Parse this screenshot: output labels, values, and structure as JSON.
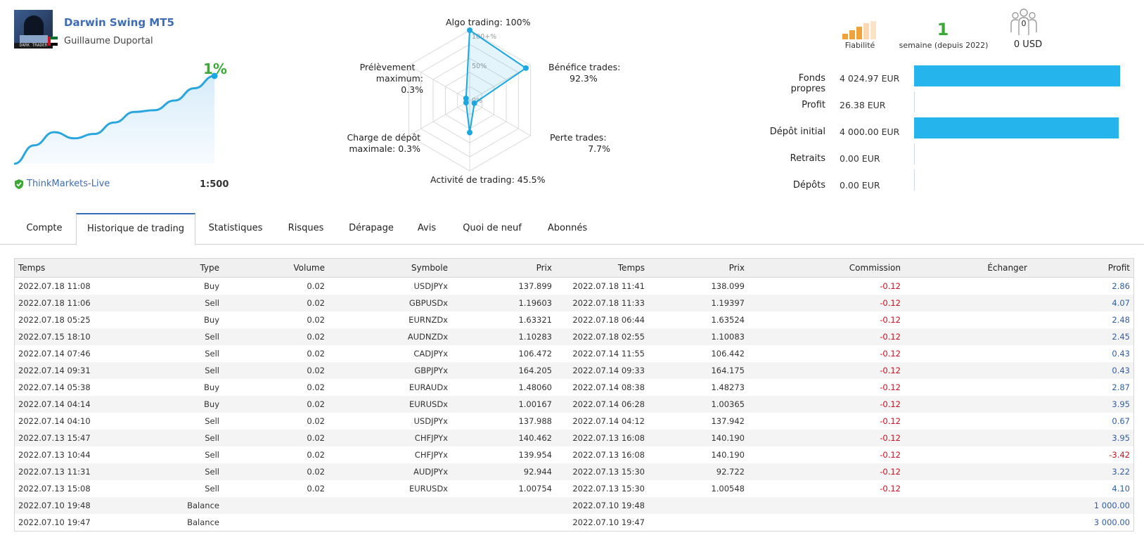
{
  "signal": {
    "title": "Darwin Swing MT5",
    "author": "Guillaume Duportal",
    "avatar_caption": "DARK TRADER",
    "growth": "1%",
    "broker": "ThinkMarkets-Live",
    "leverage": "1:500",
    "growth_curve": [
      0,
      2.1,
      3.6,
      2.9,
      3.4,
      4.7,
      5.9,
      6.1,
      7.2,
      8.6,
      10.0
    ]
  },
  "radar": {
    "labels": {
      "algo": "Algo trading: 100%",
      "profit_trades_1": "Bénéfice trades:",
      "profit_trades_2": "92.3%",
      "loss_trades_1": "Perte trades:",
      "loss_trades_2": "7.7%",
      "activity": "Activité de trading: 45.5%",
      "deposit_load_1": "Charge de dépôt",
      "deposit_load_2": "maximale: 0.3%",
      "drawdown_1": "Prélèvement",
      "drawdown_2": "maximum: 0.3%"
    },
    "ring_labels": [
      "100+%",
      "50%",
      "0%"
    ],
    "axes": [
      "Algo trading",
      "Bénéfice trades",
      "Perte trades",
      "Activité de trading",
      "Charge de dépôt maximale",
      "Prélèvement maximum"
    ],
    "values": [
      100,
      92.3,
      7.7,
      45.5,
      0.3,
      0.3
    ],
    "color": "#1ba7e0"
  },
  "stats": {
    "reliability_label": "Fiabilité",
    "weeks_num": "1",
    "weeks_label": "semaine (depuis 2022)",
    "subscribers_count": "0",
    "price": "0 USD"
  },
  "finances": [
    {
      "label": "Fonds propres",
      "value": "4 024.97 EUR",
      "fill": 1.0
    },
    {
      "label": "Profit",
      "value": "26.38 EUR",
      "fill": 0.0
    },
    {
      "label": "Dépôt initial",
      "value": "4 000.00 EUR",
      "fill": 0.994
    },
    {
      "label": "Retraits",
      "value": "0.00 EUR",
      "fill": 0.0
    },
    {
      "label": "Dépôts",
      "value": "0.00 EUR",
      "fill": 0.0
    }
  ],
  "tabs": [
    "Compte",
    "Historique de trading",
    "Statistiques",
    "Risques",
    "Dérapage",
    "Avis",
    "Quoi de neuf",
    "Abonnés"
  ],
  "active_tab": 1,
  "table": {
    "headers": [
      "Temps",
      "Type",
      "Volume",
      "Symbole",
      "Prix",
      "Temps",
      "Prix",
      "Commission",
      "Échanger",
      "Profit"
    ],
    "rows": [
      [
        "2022.07.18 11:08",
        "Buy",
        "0.02",
        "USDJPYx",
        "137.899",
        "2022.07.18 11:41",
        "138.099",
        "-0.12",
        "",
        "2.86"
      ],
      [
        "2022.07.18 11:06",
        "Sell",
        "0.02",
        "GBPUSDx",
        "1.19603",
        "2022.07.18 11:33",
        "1.19397",
        "-0.12",
        "",
        "4.07"
      ],
      [
        "2022.07.18 05:25",
        "Buy",
        "0.02",
        "EURNZDx",
        "1.63321",
        "2022.07.18 06:44",
        "1.63524",
        "-0.12",
        "",
        "2.48"
      ],
      [
        "2022.07.15 18:10",
        "Sell",
        "0.02",
        "AUDNZDx",
        "1.10283",
        "2022.07.18 02:55",
        "1.10083",
        "-0.12",
        "",
        "2.45"
      ],
      [
        "2022.07.14 07:46",
        "Sell",
        "0.02",
        "CADJPYx",
        "106.472",
        "2022.07.14 11:55",
        "106.442",
        "-0.12",
        "",
        "0.43"
      ],
      [
        "2022.07.14 09:31",
        "Sell",
        "0.02",
        "GBPJPYx",
        "164.205",
        "2022.07.14 09:33",
        "164.175",
        "-0.12",
        "",
        "0.43"
      ],
      [
        "2022.07.14 05:38",
        "Buy",
        "0.02",
        "EURAUDx",
        "1.48060",
        "2022.07.14 08:38",
        "1.48273",
        "-0.12",
        "",
        "2.87"
      ],
      [
        "2022.07.14 04:14",
        "Buy",
        "0.02",
        "EURUSDx",
        "1.00167",
        "2022.07.14 06:28",
        "1.00365",
        "-0.12",
        "",
        "3.95"
      ],
      [
        "2022.07.14 04:10",
        "Sell",
        "0.02",
        "USDJPYx",
        "137.988",
        "2022.07.14 04:12",
        "137.942",
        "-0.12",
        "",
        "0.67"
      ],
      [
        "2022.07.13 15:47",
        "Sell",
        "0.02",
        "CHFJPYx",
        "140.462",
        "2022.07.13 16:08",
        "140.190",
        "-0.12",
        "",
        "3.95"
      ],
      [
        "2022.07.13 10:44",
        "Sell",
        "0.02",
        "CHFJPYx",
        "139.954",
        "2022.07.13 16:08",
        "140.190",
        "-0.12",
        "",
        "-3.42"
      ],
      [
        "2022.07.13 11:31",
        "Sell",
        "0.02",
        "AUDJPYx",
        "92.944",
        "2022.07.13 15:30",
        "92.722",
        "-0.12",
        "",
        "3.22"
      ],
      [
        "2022.07.13 15:08",
        "Sell",
        "0.02",
        "EURUSDx",
        "1.00754",
        "2022.07.13 15:30",
        "1.00548",
        "-0.12",
        "",
        "4.10"
      ],
      [
        "2022.07.10 19:48",
        "Balance",
        "",
        "",
        "",
        "2022.07.10 19:48",
        "",
        "",
        "",
        "1 000.00"
      ],
      [
        "2022.07.10 19:47",
        "Balance",
        "",
        "",
        "",
        "2022.07.10 19:47",
        "",
        "",
        "",
        "3 000.00"
      ]
    ]
  },
  "colors": {
    "accent_blue": "#3d6db5",
    "green": "#3aaa35",
    "bar_blue": "#25b5ec",
    "negative": "#c1121f",
    "reliability": "#f0a23a"
  }
}
